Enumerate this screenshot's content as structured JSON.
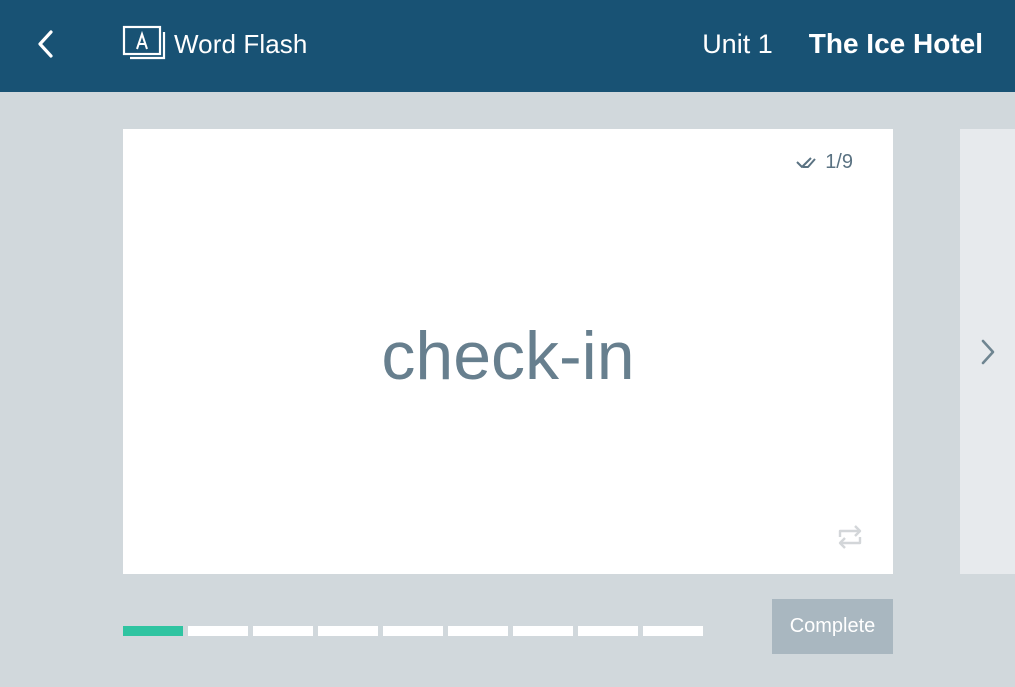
{
  "header": {
    "app_name": "Word Flash",
    "unit": "Unit 1",
    "lesson_title": "The Ice Hotel",
    "background_color": "#185274",
    "icons": {
      "back": "chevron-left-icon",
      "brand": "flashcard-letter-a-icon"
    }
  },
  "card": {
    "counter": "1/9",
    "word": "check-in",
    "icons": {
      "counter": "double-check-icon",
      "flip": "flip-card-icon"
    }
  },
  "next_panel": {
    "icon": "chevron-right-icon"
  },
  "progress": {
    "current": 1,
    "total": 9,
    "active_color": "#2fc4a1"
  },
  "actions": {
    "complete_label": "Complete"
  }
}
